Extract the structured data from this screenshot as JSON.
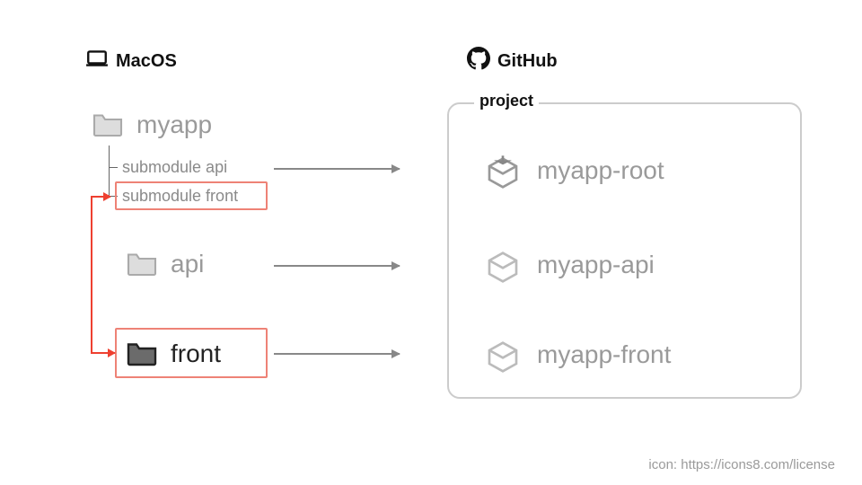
{
  "headers": {
    "left": "MacOS",
    "right": "GitHub"
  },
  "local": {
    "root_folder": "myapp",
    "submodules": [
      "submodule api",
      "submodule front"
    ],
    "folders": [
      "api",
      "front"
    ]
  },
  "project": {
    "label": "project",
    "repos": [
      "myapp-root",
      "myapp-api",
      "myapp-front"
    ]
  },
  "attribution": "icon: https://icons8.com/license",
  "colors": {
    "highlight_box": "#ee8276",
    "highlight_arrow": "#ee4030",
    "muted_text": "#9a9a9a",
    "arrow": "#888888"
  }
}
